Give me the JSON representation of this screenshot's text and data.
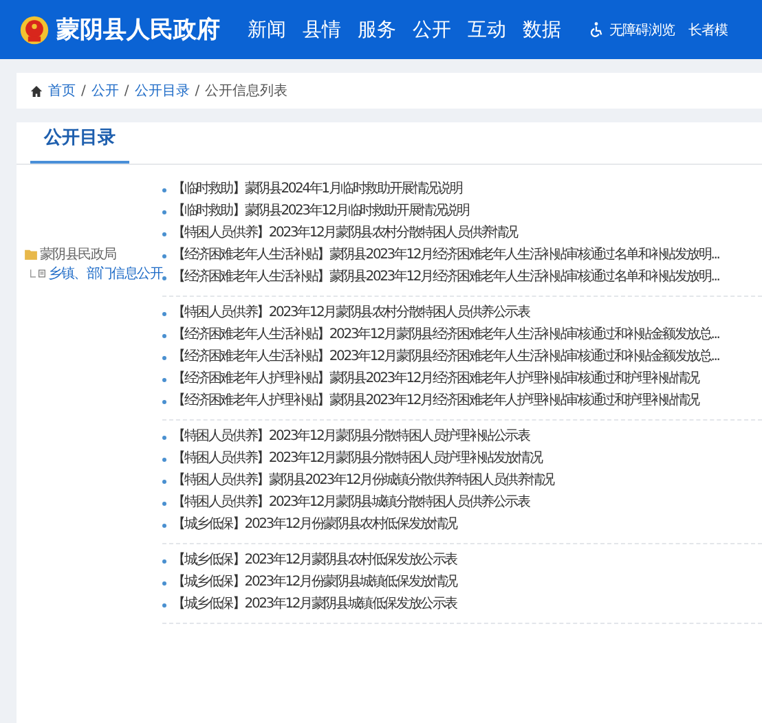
{
  "header": {
    "site_title": "蒙阴县人民政府",
    "nav": [
      "新闻",
      "县情",
      "服务",
      "公开",
      "互动",
      "数据"
    ],
    "tools": [
      {
        "kind": "accessibility",
        "label": "无障碍浏览"
      },
      {
        "kind": "plain",
        "label": "长者模"
      }
    ]
  },
  "breadcrumb": {
    "separator": "/",
    "items": [
      "首页",
      "公开",
      "公开目录",
      "公开信息列表"
    ]
  },
  "panel": {
    "tab": "公开目录",
    "tree": [
      {
        "label": "蒙阴县民政局",
        "children": [
          {
            "label": "乡镇、部门信息公开"
          }
        ]
      }
    ],
    "groups": [
      [
        "【临时救助】蒙阴县2024年1月临时救助开展情况说明",
        "【临时救助】蒙阴县2023年12月临时救助开展情况说明",
        "【特困人员供养】2023年12月蒙阴县农村分散特困人员供养情况",
        "【经济困难老年人生活补贴】蒙阴县2023年12月经济困难老年人生活补贴审核通过名单和补贴发放明...",
        "【经济困难老年人生活补贴】蒙阴县2023年12月经济困难老年人生活补贴审核通过名单和补贴发放明..."
      ],
      [
        "【特困人员供养】2023年12月蒙阴县农村分散特困人员供养公示表",
        "【经济困难老年人生活补贴】2023年12月蒙阴县经济困难老年人生活补贴审核通过和补贴金额发放总...",
        "【经济困难老年人生活补贴】2023年12月蒙阴县经济困难老年人生活补贴审核通过和补贴金额发放总...",
        "【经济困难老年人护理补贴】蒙阴县2023年12月经济困难老年人护理补贴审核通过和护理补贴情况",
        "【经济困难老年人护理补贴】蒙阴县2023年12月经济困难老年人护理补贴审核通过和护理补贴情况"
      ],
      [
        "【特困人员供养】2023年12月蒙阴县分散特困人员护理补贴公示表",
        "【特困人员供养】2023年12月蒙阴县分散特困人员护理补贴发放情况",
        "【特困人员供养】蒙阴县2023年12月份城镇分散供养特困人员供养情况",
        "【特困人员供养】2023年12月蒙阴县城镇分散特困人员供养公示表",
        "【城乡低保】2023年12月份蒙阴县农村低保发放情况"
      ],
      [
        "【城乡低保】2023年12月蒙阴县农村低保发放公示表",
        "【城乡低保】2023年12月份蒙阴县城镇低保发放情况",
        "【城乡低保】2023年12月蒙阴县城镇低保发放公示表"
      ]
    ]
  }
}
